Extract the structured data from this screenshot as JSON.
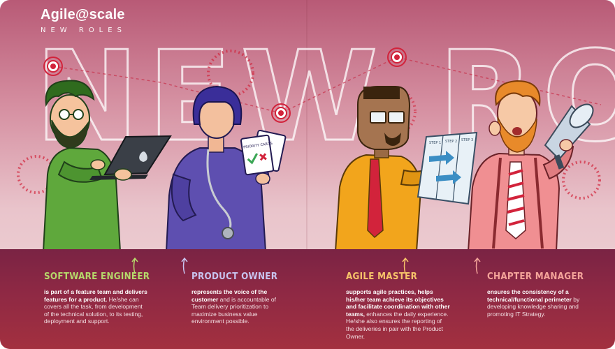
{
  "brand": {
    "title": "Agile@scale",
    "subtitle": "NEW ROLES"
  },
  "hero_title": "NEW ROLES",
  "props": {
    "cards_label": "PRIORITY CARDS",
    "board_steps": [
      "STEP 1",
      "STEP 2",
      "STEP 3"
    ]
  },
  "roles": [
    {
      "title": "SOFTWARE ENGINEER",
      "color": "#b6d96b",
      "desc_bold": "is part of a feature team and delivers features for a product.",
      "desc": " He/she can covers all the task, from development of the technical solution, to its testing, deployment and support."
    },
    {
      "title": "PRODUCT OWNER",
      "color": "#c9c4ef",
      "desc_bold": "represents the voice of the customer",
      "desc": " and is accountable of Team delivery prioritization to maximize business value environment possible."
    },
    {
      "title": "AGILE MASTER",
      "color": "#f7c46a",
      "desc_bold": "supports agile practices, helps his/her team achieve its objectives and facilitate coordination with other teams,",
      "desc": " enhances the daily experience. He/she also ensures the reporting of the deliveries in pair with the Product Owner."
    },
    {
      "title": "CHAPTER MANAGER",
      "color": "#f4a49a",
      "desc_bold": "ensures the consistency of a technical/functional perimeter",
      "desc": " by developing knowledge sharing and promoting IT Strategy."
    }
  ],
  "colors": {
    "bottom_band": "#8f2944",
    "engineer_shirt": "#5fa83c",
    "owner_suit": "#5e4fb0",
    "master_shirt": "#f2a51c",
    "manager_shirt": "#f08f92",
    "target": "#d2233b"
  }
}
